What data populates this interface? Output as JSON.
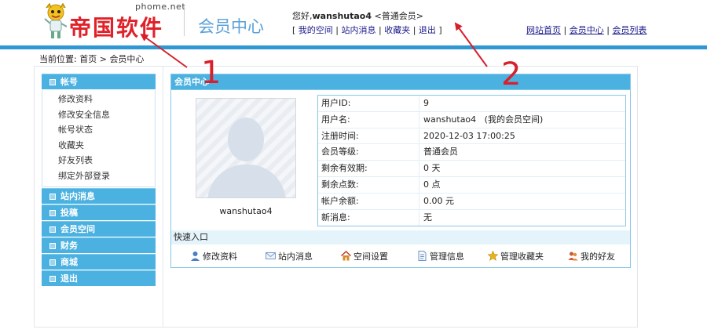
{
  "header": {
    "logo_domain": "phome.net",
    "logo_name": "帝国软件",
    "title": "会员中心",
    "greeting_prefix": "您好,",
    "username": "wanshutao4",
    "member_group": "<普通会员>",
    "user_links": [
      "我的空间",
      "站内消息",
      "收藏夹",
      "退出"
    ],
    "top_links": [
      "网站首页",
      "会员中心",
      "会员列表"
    ]
  },
  "breadcrumb": {
    "label": "当前位置:",
    "home": "首页",
    "sep": ">",
    "current": "会员中心"
  },
  "sidebar": {
    "groups": [
      {
        "title": "帐号",
        "items": [
          "修改资料",
          "修改安全信息",
          "帐号状态",
          "收藏夹",
          "好友列表",
          "绑定外部登录"
        ]
      },
      {
        "title": "站内消息"
      },
      {
        "title": "投稿"
      },
      {
        "title": "会员空间"
      },
      {
        "title": "财务"
      },
      {
        "title": "商城"
      },
      {
        "title": "退出"
      }
    ]
  },
  "content": {
    "title": "会员中心",
    "avatar_name": "wanshutao4",
    "info": [
      {
        "label": "用户ID:",
        "value": "9"
      },
      {
        "label": "用户名:",
        "value": "wanshutao4",
        "extra": "(我的会员空间)"
      },
      {
        "label": "注册时间:",
        "value": "2020-12-03 17:00:25"
      },
      {
        "label": "会员等级:",
        "value": "普通会员"
      },
      {
        "label": "剩余有效期:",
        "value": "0 天"
      },
      {
        "label": "剩余点数:",
        "value": "0 点"
      },
      {
        "label": "帐户余额:",
        "value": "0.00 元"
      },
      {
        "label": "新消息:",
        "value": "无"
      }
    ],
    "quick_title": "快速入口",
    "quick_links": [
      {
        "label": "修改资料",
        "icon": "user-edit-icon",
        "color": "#4a7fc4"
      },
      {
        "label": "站内消息",
        "icon": "envelope-icon",
        "color": "#7a9cc8"
      },
      {
        "label": "空间设置",
        "icon": "house-icon",
        "color": "#d98a2a"
      },
      {
        "label": "管理信息",
        "icon": "document-icon",
        "color": "#6b93c4"
      },
      {
        "label": "管理收藏夹",
        "icon": "star-icon",
        "color": "#e8b21a"
      },
      {
        "label": "我的好友",
        "icon": "friends-icon",
        "color": "#c95a3a"
      }
    ]
  },
  "annotations": {
    "label_1": "1",
    "label_2": "2",
    "color": "#d8202c"
  },
  "colors": {
    "accent": "#4bb1e0",
    "bar": "#2f97d2",
    "title": "#5aa0d8",
    "brand": "#e0212a"
  }
}
